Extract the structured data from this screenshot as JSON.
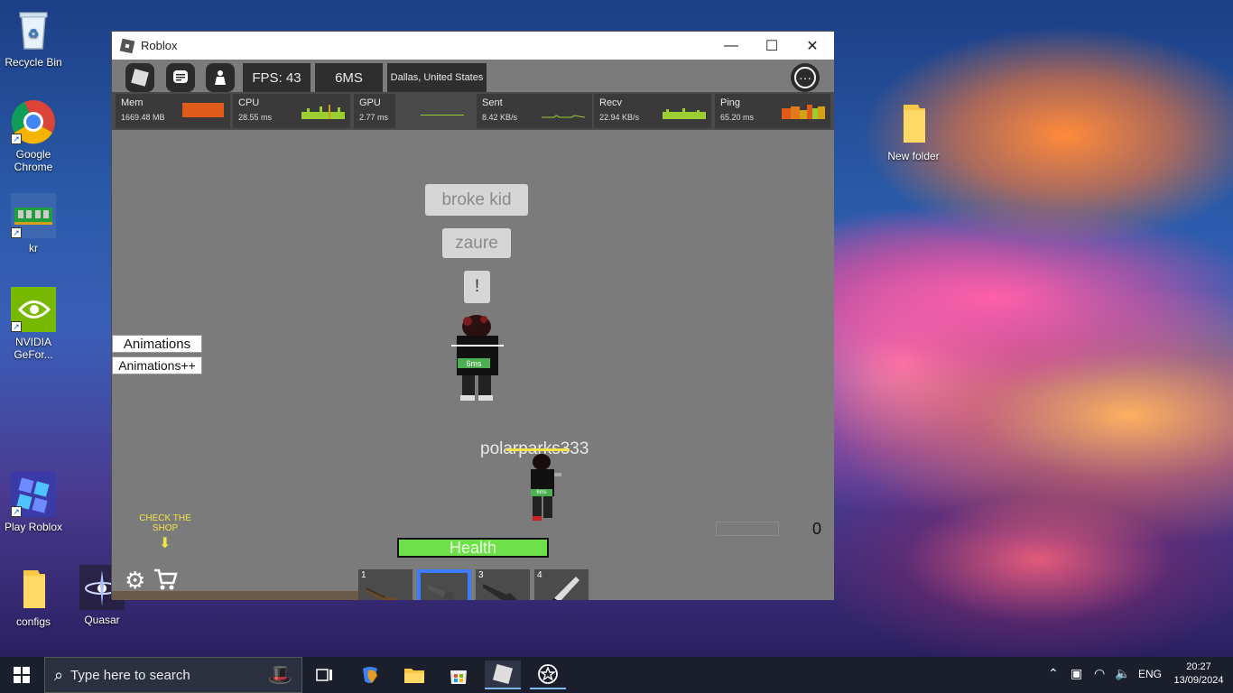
{
  "desktop": {
    "icons": [
      {
        "label": "Recycle Bin"
      },
      {
        "label": "Google Chrome"
      },
      {
        "label": "kr"
      },
      {
        "label": "NVIDIA GeFor..."
      },
      {
        "label": "Play Roblox"
      },
      {
        "label": "configs"
      },
      {
        "label": "Quasar"
      },
      {
        "label": "New folder"
      }
    ]
  },
  "window": {
    "title": "Roblox",
    "minimize_glyph": "—",
    "maximize_glyph": "☐",
    "close_glyph": "✕"
  },
  "topbar": {
    "fps": "FPS: 43",
    "ms": "6MS",
    "location": "Dallas, United States",
    "more_glyph": "···"
  },
  "perf": {
    "mem_label": "Mem",
    "mem_value": "1669.48 MB",
    "cpu_label": "CPU",
    "cpu_value": "28.55 ms",
    "gpu_label": "GPU",
    "gpu_value": "2.77 ms",
    "sent_label": "Sent",
    "sent_value": "8.42 KB/s",
    "recv_label": "Recv",
    "recv_value": "22.94 KB/s",
    "ping_label": "Ping",
    "ping_value": "65.20 ms"
  },
  "game": {
    "bubble1": "broke kid",
    "bubble2": "zaure",
    "bubble3": "!",
    "player_tag": "6ms",
    "player_name": "polarparks333",
    "player2_tag": "6ms",
    "anim_btn1": "Animations",
    "anim_btn2": "Animations++",
    "shop_hint": "CHECK THE SHOP",
    "health_label": "Health",
    "health_fraction": 1.0,
    "score": "0"
  },
  "hotbar": {
    "slots": [
      {
        "num": "1",
        "item": "shotgun-icon"
      },
      {
        "num": "",
        "item": "revolver-icon",
        "selected": true
      },
      {
        "num": "3",
        "item": "shotgun-icon"
      },
      {
        "num": "4",
        "item": "knife-icon"
      }
    ]
  },
  "taskbar": {
    "search_placeholder": "Type here to search",
    "lang": "ENG",
    "time": "20:27",
    "date": "13/09/2024"
  },
  "colors": {
    "health": "#6de04a",
    "accent_selected": "#3b7cff",
    "taskbar": "#1a1f2b"
  }
}
